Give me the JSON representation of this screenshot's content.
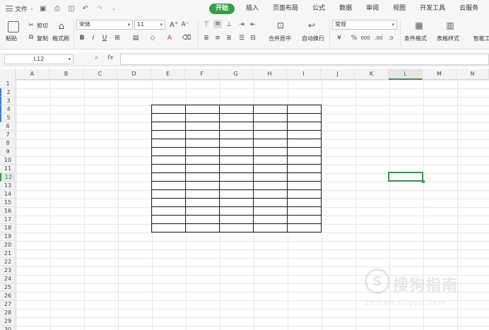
{
  "menu": {
    "file_label": "文件"
  },
  "tabs": [
    {
      "label": "开始",
      "active": true
    },
    {
      "label": "插入"
    },
    {
      "label": "页面布局"
    },
    {
      "label": "公式"
    },
    {
      "label": "数据"
    },
    {
      "label": "审阅"
    },
    {
      "label": "视图"
    },
    {
      "label": "开发工具"
    },
    {
      "label": "云服务"
    }
  ],
  "ribbon": {
    "paste": "粘贴",
    "cut": "剪切",
    "copy": "复制",
    "format_painter": "格式刷",
    "font_name": "宋体",
    "font_size": "11",
    "bold": "B",
    "italic": "I",
    "underline": "U",
    "merge_center": "合并居中",
    "wrap_text": "自动换行",
    "number_format": "常规",
    "percent": "%",
    "conditional_format": "条件格式",
    "table_style": "表格样式",
    "smart": "智能工"
  },
  "formula_bar": {
    "cell_ref": "L12",
    "fx": "fx",
    "value": ""
  },
  "sheet": {
    "columns": [
      "A",
      "B",
      "C",
      "D",
      "E",
      "F",
      "G",
      "H",
      "I",
      "J",
      "K",
      "L",
      "M",
      "N"
    ],
    "selected_column": "L",
    "rows": [
      "1",
      "2",
      "3",
      "4",
      "5",
      "6",
      "7",
      "8",
      "9",
      "10",
      "11",
      "12",
      "13",
      "14",
      "15",
      "16",
      "17",
      "18",
      "19",
      "20",
      "21",
      "22",
      "23",
      "24",
      "25",
      "26",
      "27",
      "28",
      "29",
      "30"
    ],
    "selected_row": "12"
  },
  "watermark": {
    "text": "搜狗指南",
    "url": "zhinan.sogou.com"
  },
  "colors": {
    "accent": "#3a9b4b",
    "toolbar_bg": "#f6f6f6",
    "grid": "#e6e6e6"
  }
}
